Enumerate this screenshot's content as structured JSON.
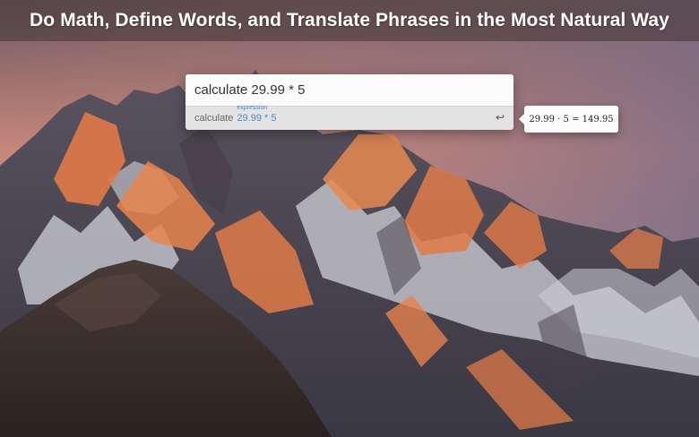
{
  "banner": {
    "title": "Do Math, Define Words, and Translate Phrases in the Most Natural Way"
  },
  "launcher": {
    "query": "calculate 29.99 * 5",
    "result": {
      "command": "calculate",
      "argument_label": "expression",
      "argument_value": "29.99 * 5",
      "return_icon": "↩"
    }
  },
  "answer": {
    "text": "29.99 · 5 = 149.95"
  },
  "wallpaper": {
    "name": "mountain-sunset-wallpaper",
    "colors": {
      "sky_top": "#5a4a5e",
      "sky_bottom": "#c98a86",
      "rock_lit": "#e0784a",
      "rock_dark": "#3a3334",
      "snow": "#d9d8df"
    }
  }
}
